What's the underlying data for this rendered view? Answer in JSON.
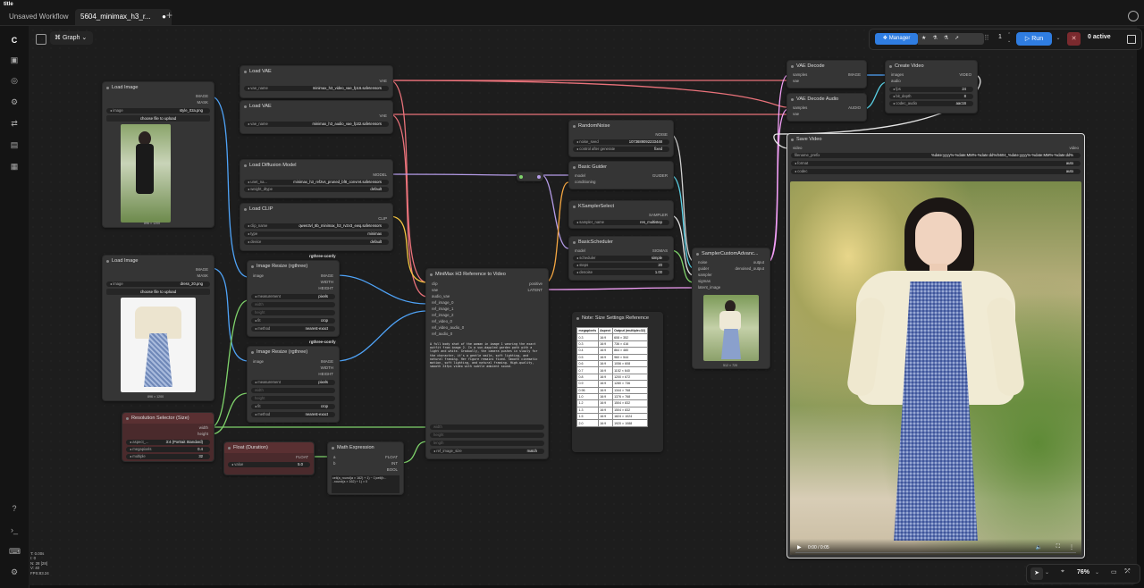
{
  "app": {
    "name": "title"
  },
  "tabs": [
    {
      "label": "Unsaved Workflow",
      "modified": true
    },
    {
      "label": "5604_minimax_h3_r...",
      "modified": true
    }
  ],
  "graph_button": "Graph",
  "toolbar": {
    "manager": "Manager",
    "queue_count": "1",
    "run": "Run",
    "active": "0 active"
  },
  "zoom": "76%",
  "stats": [
    "T: 0.00s",
    "I: 0",
    "N: 28 [28]",
    "V: 40",
    "FPS:83.24"
  ],
  "nodes": {
    "load_image_1": {
      "title": "Load Image",
      "out1": "IMAGE",
      "out2": "MASK",
      "widget_label": "image",
      "widget_value": "style_02a.png",
      "upload": "choose file to upload",
      "caption": "896 × 1200"
    },
    "load_image_2": {
      "title": "Load Image",
      "out1": "IMAGE",
      "out2": "MASK",
      "widget_label": "image",
      "widget_value": "dress_20.png",
      "upload": "choose file to upload",
      "caption": "896 × 1200"
    },
    "load_vae_1": {
      "title": "Load VAE",
      "out": "VAE",
      "widget_label": "vae_name",
      "widget_value": "minimax_h3_video_vae_fp16.safetensors"
    },
    "load_vae_2": {
      "title": "Load VAE",
      "out": "VAE",
      "widget_label": "vae_name",
      "widget_value": "minimax_h3_audio_vae_fp32.safetensors"
    },
    "load_diffusion": {
      "title": "Load Diffusion Model",
      "out": "MODEL",
      "w1_label": "unet_na...",
      "w1_value": "minimax_h3_ref2vs_pruned_bf8_convret.safetensors",
      "w2_label": "weight_dtype",
      "w2_value": "default"
    },
    "load_clip": {
      "title": "Load CLIP",
      "out": "CLIP",
      "w1_label": "clip_name",
      "w1_value": "qwen3vl_8b_minimax_h3_rv2v3_ewq.safetensors",
      "w2_label": "type",
      "w2_value": "minimax",
      "w3_label": "device",
      "w3_value": "default"
    },
    "resize_1": {
      "tag": "rgthree-comfy",
      "title": "Image Resize (rgthree)",
      "in": "image",
      "out1": "IMAGE",
      "out2": "WIDTH",
      "out3": "HEIGHT",
      "w1_label": "measurement",
      "w1_value": "pixels",
      "w2": "width",
      "w3": "height",
      "w4_label": "fit",
      "w4_value": "crop",
      "w5_label": "method",
      "w5_value": "nearest-exact"
    },
    "resize_2": {
      "tag": "rgthree-comfy",
      "title": "Image Resize (rgthree)",
      "in": "image",
      "out1": "IMAGE",
      "out2": "WIDTH",
      "out3": "HEIGHT",
      "w1_label": "measurement",
      "w1_value": "pixels",
      "w2": "width",
      "w3": "height",
      "w4_label": "fit",
      "w4_value": "crop",
      "w5_label": "method",
      "w5_value": "nearest-exact"
    },
    "resolution": {
      "title": "Resolution Selector (Size)",
      "out1": "width",
      "out2": "height",
      "w1_label": "aspect_...",
      "w1_value": "3:4 (Portrait Standard)",
      "w2_label": "megapixels",
      "w2_value": "0.4",
      "w3_label": "multiple",
      "w3_value": "32"
    },
    "float": {
      "title": "Float (Duration)",
      "out": "FLOAT",
      "w_label": "value",
      "w_value": "5.0"
    },
    "math": {
      "title": "Math Expression",
      "in1": "a",
      "in2": "b",
      "out1": "FLOAT",
      "out2": "INT",
      "out3": "BOOL",
      "expr": "ceil(a_round(a × 162) + 1) − 1)ceil(b...\n..round(a × 162) + 1) × 0"
    },
    "minimax": {
      "title": "MiniMax H3 Reference to Video",
      "inputs": [
        "clip",
        "vae",
        "audio_vae",
        "ref_image_0",
        "ref_image_1",
        "ref_image_2",
        "ref_video_0",
        "ref_video_audio_0",
        "ref_audio_0"
      ],
      "out1": "positive",
      "out2": "LATENT",
      "prompt": "A full body shot of the woman in image 1 wearing the exact outfit from image 2. In a sun-dappled garden path with a light and white. Gradually, the camera pushes in slowly for the character, it's a gentle smile, soft lighting, and natural framing. Her figure remains fixed. Smooth cinematic motion, soft lighting, and natural framing. High-quality, smooth 24fps video with subtle ambient sound.",
      "w1": "width",
      "w2": "height",
      "w3": "length",
      "w4_label": "ref_image_size",
      "w4_value": "match"
    },
    "random_noise": {
      "title": "RandomNoise",
      "out": "NOISE",
      "w1_label": "noise_seed",
      "w1_value": "1073689092233448",
      "w2_label": "control after generate",
      "w2_value": "fixed"
    },
    "basic_guider": {
      "title": "Basic Guider",
      "in1": "model",
      "in2": "conditioning",
      "out": "GUIDER"
    },
    "ksampler_select": {
      "title": "KSamplerSelect",
      "out": "SAMPLER",
      "w_label": "sampler_name",
      "w_value": "res_multistep"
    },
    "basic_scheduler": {
      "title": "BasicScheduler",
      "in": "model",
      "out": "SIGMAS",
      "w1_label": "scheduler",
      "w1_value": "simple",
      "w2_label": "steps",
      "w2_value": "20",
      "w3_label": "denoise",
      "w3_value": "1.00"
    },
    "sampler_custom": {
      "title": "SamplerCustomAdvanc...",
      "inputs": [
        "noise",
        "guider",
        "sampler",
        "sigmas",
        "latent_image"
      ],
      "out1": "output",
      "out2": "denoised_output",
      "caption": "512 × 720"
    },
    "vae_decode": {
      "title": "VAE Decode",
      "in1": "samples",
      "in2": "vae",
      "out": "IMAGE"
    },
    "vae_decode_audio": {
      "title": "VAE Decode Audio",
      "in1": "samples",
      "in2": "vae",
      "out": "AUDIO"
    },
    "create_video": {
      "title": "Create Video",
      "in1": "images",
      "in2": "audio",
      "out": "VIDEO",
      "w1_label": "fps",
      "w1_value": "24",
      "w2_label": "bit_depth",
      "w2_value": "8",
      "w3_label": "codec_audio",
      "w3_value": "aac16"
    },
    "save_video": {
      "title": "Save Video",
      "in": "video",
      "out": "video",
      "w1_label": "filename_prefix",
      "w1_value": "%date:yyyy%-%date:MM%-%date:dd%/5604_%date:yyyy%-%date:MM%-%date:dd%",
      "w2_label": "format",
      "w2_value": "auto",
      "w3_label": "codec",
      "w3_value": "auto",
      "time": "0:00 / 0:05"
    },
    "note": {
      "title": "Note: Size Settings Reference",
      "headers": [
        "megapixels",
        "Aspect",
        "Output (multiple=32)"
      ],
      "rows": [
        [
          "0.3",
          "16:9",
          "608 × 352"
        ],
        [
          "0.3",
          "16:9",
          "736 × 416"
        ],
        [
          "0.4",
          "16:9",
          "864 × 480"
        ],
        [
          "0.5",
          "16:9",
          "960 × 544"
        ],
        [
          "0.6",
          "16:9",
          "1056 × 608"
        ],
        [
          "0.7",
          "16:9",
          "1152 × 640"
        ],
        [
          "0.8",
          "16:9",
          "1200 × 672"
        ],
        [
          "0.9",
          "16:9",
          "1280 × 736"
        ],
        [
          "0.96",
          "16:9",
          "1344 × 768"
        ],
        [
          "1.0",
          "16:9",
          "1376 × 768"
        ],
        [
          "1.2",
          "16:9",
          "1504 × 832"
        ],
        [
          "1.3",
          "16:9",
          "1504 × 832"
        ],
        [
          "1.5",
          "16:9",
          "1824 × 1024"
        ],
        [
          "2.0",
          "16:9",
          "1920 × 1088"
        ]
      ]
    }
  },
  "colors": {
    "accent": "#2f7de1",
    "link_vae": "#e9727a",
    "link_image": "#4fa3f7",
    "link_model": "#b59ce8",
    "link_clip": "#f5c542",
    "link_latent": "#f39ff7",
    "link_int": "#7fd36b"
  }
}
